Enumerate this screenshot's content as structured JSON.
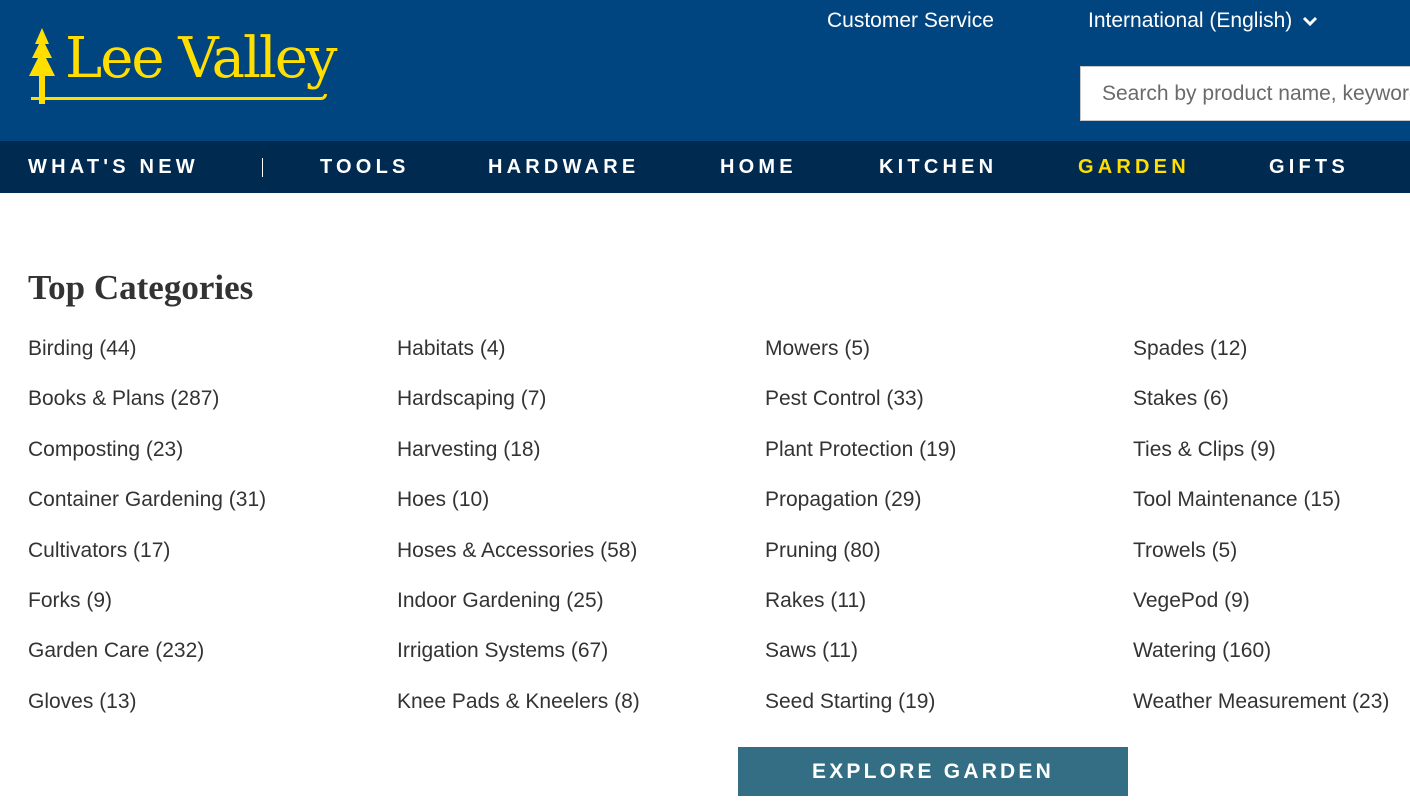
{
  "header": {
    "logo_text": "Lee Valley",
    "customer_service": "Customer Service",
    "language": "International (English)",
    "search_placeholder": "Search by product name, keyword",
    "colors": {
      "brand_blue": "#004480",
      "nav_dark": "#002a4f",
      "accent_yellow": "#ffde00"
    }
  },
  "nav": {
    "items": [
      "WHAT'S NEW",
      "TOOLS",
      "HARDWARE",
      "HOME",
      "KITCHEN",
      "GARDEN",
      "GIFTS"
    ],
    "active": "GARDEN"
  },
  "main": {
    "title": "Top Categories",
    "columns": [
      [
        "Birding (44)",
        "Books & Plans (287)",
        "Composting (23)",
        "Container Gardening (31)",
        "Cultivators (17)",
        "Forks (9)",
        "Garden Care (232)",
        "Gloves (13)"
      ],
      [
        "Habitats (4)",
        "Hardscaping (7)",
        "Harvesting (18)",
        "Hoes (10)",
        "Hoses & Accessories (58)",
        "Indoor Gardening (25)",
        "Irrigation Systems (67)",
        "Knee Pads & Kneelers (8)"
      ],
      [
        "Mowers (5)",
        "Pest Control (33)",
        "Plant Protection (19)",
        "Propagation (29)",
        "Pruning (80)",
        "Rakes (11)",
        "Saws (11)",
        "Seed Starting (19)"
      ],
      [
        "Spades (12)",
        "Stakes (6)",
        "Ties & Clips (9)",
        "Tool Maintenance (15)",
        "Trowels (5)",
        "VegePod (9)",
        "Watering (160)",
        "Weather Measurement (23)"
      ]
    ],
    "explore_button": "EXPLORE GARDEN"
  }
}
